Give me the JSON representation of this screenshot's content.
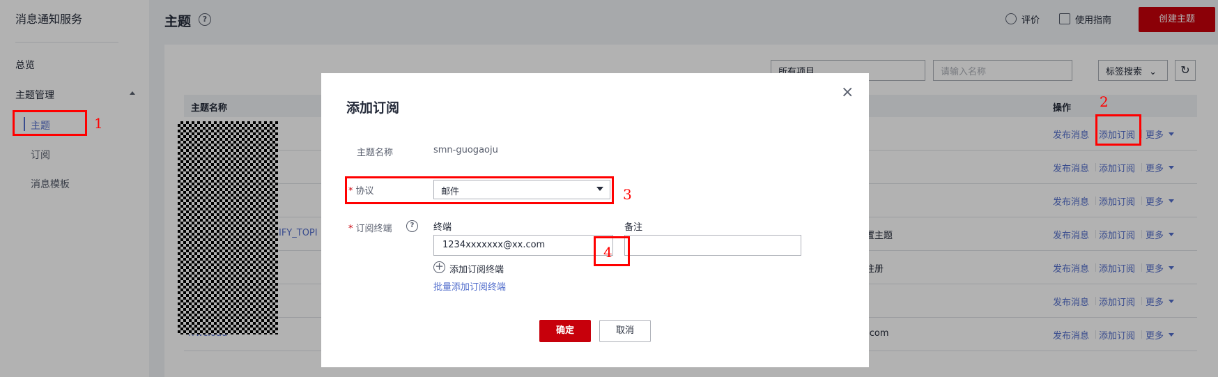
{
  "sidebar": {
    "title": "消息通知服务",
    "overview": "总览",
    "topic_mgmt": "主题管理",
    "topic": "主题",
    "subscription": "订阅",
    "template": "消息模板"
  },
  "header": {
    "title": "主题",
    "help": "?",
    "rate": "评价",
    "guide": "使用指南",
    "create": "创建主题"
  },
  "toolbar": {
    "project": "所有项目",
    "search_placeholder": "请输入名称",
    "tag_search": "标签搜索",
    "refresh": "↻"
  },
  "table": {
    "col_name": "主题名称",
    "col_ops": "操作",
    "op_publish": "发布消息",
    "op_subscribe": "添加订阅",
    "op_more": "更多",
    "fragments": {
      "row4_name": "IFY_TOPI",
      "row4_desc": "置主题",
      "row5_desc": "注册",
      "row7_name": "rrwcloud",
      "row7_desc": "i.com"
    }
  },
  "modal": {
    "title": "添加订阅",
    "close": "×",
    "topic_name_label": "主题名称",
    "topic_name_value": "smn-guogaoju",
    "req": "*",
    "protocol_label": "协议",
    "protocol_value": "邮件",
    "endpoint_label": "订阅终端",
    "col_endpoint": "终端",
    "col_remark": "备注",
    "endpoint_value": "1234xxxxxxx@xx.com",
    "remark_value": "",
    "add_endpoint": "添加订阅终端",
    "batch_add": "批量添加订阅终端",
    "ok": "确定",
    "cancel": "取消"
  },
  "annotations": [
    "1",
    "2",
    "3",
    "4"
  ],
  "colors": {
    "brand_red": "#c7000b",
    "link_blue": "#526ecc",
    "annotation_red": "#ff0000"
  }
}
